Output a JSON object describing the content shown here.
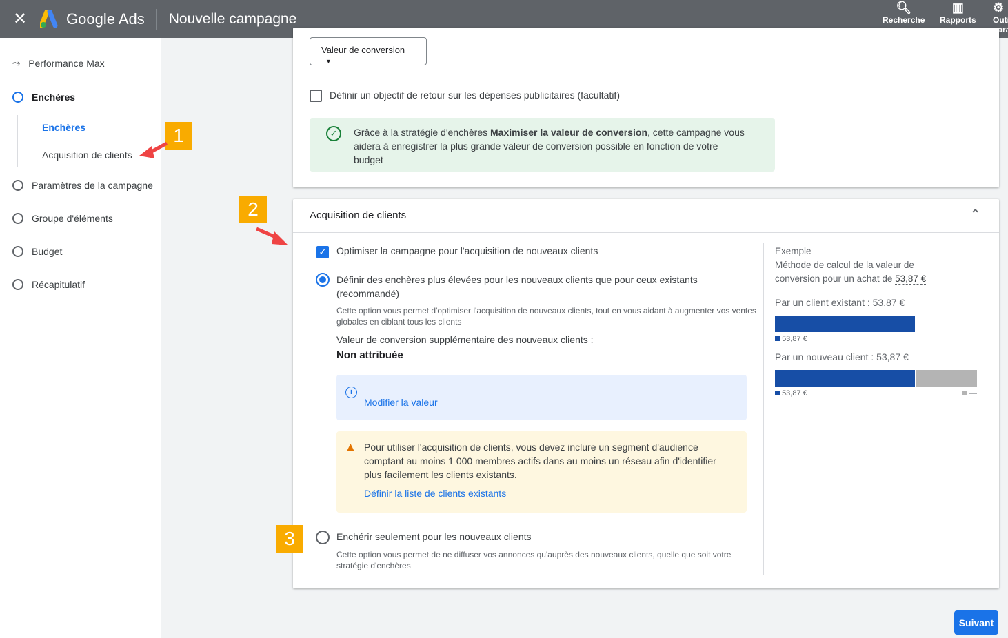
{
  "topbar": {
    "title": "Nouvelle campagne",
    "logo_text": "Google Ads",
    "actions": [
      {
        "label": "Recherche",
        "icon": "search-icon"
      },
      {
        "label": "Rapports",
        "icon": "reports-icon"
      },
      {
        "label": "Outils et paramètres",
        "icon": "tools-icon"
      }
    ]
  },
  "sidebar": {
    "campaign_type": "Performance Max",
    "items": [
      {
        "label": "Enchères",
        "active": true
      },
      {
        "label": "Paramètres de la campagne"
      },
      {
        "label": "Groupe d'éléments"
      },
      {
        "label": "Budget"
      },
      {
        "label": "Récapitulatif"
      }
    ],
    "subitems": [
      {
        "label": "Enchères",
        "active": true
      },
      {
        "label": "Acquisition de clients"
      }
    ]
  },
  "bidding": {
    "dropdown": "Valeur de conversion",
    "roas_checkbox": "Définir un objectif de retour sur les dépenses publicitaires (facultatif)",
    "info_pre": "Grâce à la stratégie d'enchères ",
    "info_bold": "Maximiser la valeur de conversion",
    "info_post": ", cette campagne vous aidera à enregistrer la plus grande valeur de conversion possible en fonction de votre budget"
  },
  "acquisition": {
    "title": "Acquisition de clients",
    "optimize_checkbox": "Optimiser la campagne pour l'acquisition de nouveaux clients",
    "option1": "Définir des enchères plus élevées pour les nouveaux clients que pour ceux existants (recommandé)",
    "option1_desc": "Cette option vous permet d'optimiser l'acquisition de nouveaux clients, tout en vous aidant à augmenter vos ventes globales en ciblant tous les clients",
    "extra_value_label": "Valeur de conversion supplémentaire des nouveaux clients :",
    "extra_value": "Non attribuée",
    "modify_link": "Modifier la valeur",
    "warning": "Pour utiliser l'acquisition de clients, vous devez inclure un segment d'audience comptant au moins 1 000 membres actifs dans au moins un réseau afin d'identifier plus facilement les clients existants.",
    "warning_link": "Définir la liste de clients existants",
    "option2": "Enchérir seulement pour les nouveaux clients",
    "option2_desc": "Cette option vous permet de ne diffuser vos annonces qu'auprès des nouveaux clients, quelle que soit votre stratégie d'enchères"
  },
  "example": {
    "heading": "Exemple",
    "desc": "Méthode de calcul de la valeur de conversion pour un achat de ",
    "amount": "53,87 €",
    "existing_label": "Par un client existant : 53,87 €",
    "existing_value": "53,87 €",
    "new_label": "Par un nouveau client : 53,87 €",
    "new_value": "53,87 €",
    "new_extra": "—",
    "colors": {
      "base": "#174ea6",
      "extra": "#b4b4b4"
    }
  },
  "footer": {
    "next": "Suivant"
  },
  "annotations": [
    "1",
    "2",
    "3"
  ]
}
